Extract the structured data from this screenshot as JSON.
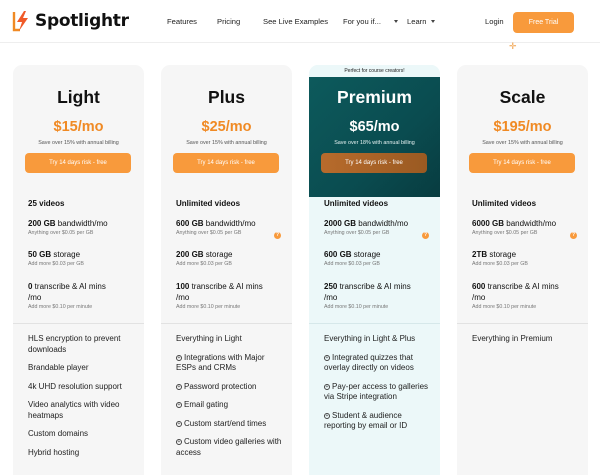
{
  "nav": {
    "brand": "Spotlightr",
    "links": [
      "Features",
      "Pricing",
      "See Live Examples",
      "For you if...",
      "Learn"
    ],
    "login": "Login",
    "trial": "Free Trial"
  },
  "plans": [
    {
      "name": "Light",
      "price": "$15/mo",
      "billing": "Save over 15% with annual billing",
      "cta": "Try 14 days risk - free",
      "videos": "25 videos",
      "bandwidth_a": "200 GB",
      "bandwidth_b": " bandwidth/mo",
      "bandwidth_sub": "Anything over $0.05 per GB",
      "storage_a": "50 GB",
      "storage_b": " storage",
      "storage_sub": "Add more $0.03 per GB",
      "transcribe_a": "0",
      "transcribe_b": " transcribe & AI mins",
      "transcribe_c": "/mo",
      "transcribe_sub": "Add more $0.10 per minute",
      "features": [
        "HLS encryption to prevent downloads",
        "Brandable player",
        "4k UHD resolution support",
        "Video analytics with video heatmaps",
        "Custom domains",
        "Hybrid hosting"
      ]
    },
    {
      "name": "Plus",
      "price": "$25/mo",
      "billing": "Save over 15% with annual billing",
      "cta": "Try 14 days risk - free",
      "videos": "Unlimited videos",
      "bandwidth_a": "600 GB",
      "bandwidth_b": " bandwidth/mo",
      "bandwidth_sub": "Anything over $0.05 per GB",
      "storage_a": "200 GB",
      "storage_b": " storage",
      "storage_sub": "Add more $0.03 per GB",
      "transcribe_a": "100",
      "transcribe_b": " transcribe & AI mins",
      "transcribe_c": "/mo",
      "transcribe_sub": "Add more $0.10 per minute",
      "features_intro": "Everything in Light",
      "features": [
        "Integrations with Major ESPs and CRMs",
        "Password protection",
        "Email gating",
        "Custom start/end times",
        "Custom video galleries with access"
      ]
    },
    {
      "name": "Premium",
      "ribbon": "Perfect for course creators!",
      "price": "$65/mo",
      "billing": "Save over 18% with annual billing",
      "cta": "Try 14 days risk - free",
      "videos": "Unlimited videos",
      "bandwidth_a": "2000 GB",
      "bandwidth_b": " bandwidth/mo",
      "bandwidth_sub": "Anything over $0.05 per GB",
      "storage_a": "600 GB",
      "storage_b": " storage",
      "storage_sub": "Add more $0.03 per GB",
      "transcribe_a": "250",
      "transcribe_b": " transcribe & AI mins",
      "transcribe_c": "/mo",
      "transcribe_sub": "Add more $0.10 per minute",
      "features_intro": "Everything in Light & Plus",
      "features": [
        "Integrated quizzes that overlay directly on videos",
        "Pay-per access to galleries via Stripe integration",
        "Student & audience reporting by email or ID"
      ]
    },
    {
      "name": "Scale",
      "price": "$195/mo",
      "billing": "Save over 15% with annual billing",
      "cta": "Try 14 days risk - free",
      "videos": "Unlimited videos",
      "bandwidth_a": "6000 GB",
      "bandwidth_b": " bandwidth/mo",
      "bandwidth_sub": "Anything over $0.05 per GB",
      "storage_a": "2TB",
      "storage_b": " storage",
      "storage_sub": "Add more $0.03 per GB",
      "transcribe_a": "600",
      "transcribe_b": " transcribe & AI mins",
      "transcribe_c": "/mo",
      "transcribe_sub": "Add more $0.10 per minute",
      "features_intro": "Everything in Premium"
    }
  ],
  "help_glyph": "?",
  "plus_glyph": "+",
  "colors": {
    "accent": "#f89a3c",
    "price": "#f08a24",
    "premium": "#0d5a5c"
  }
}
